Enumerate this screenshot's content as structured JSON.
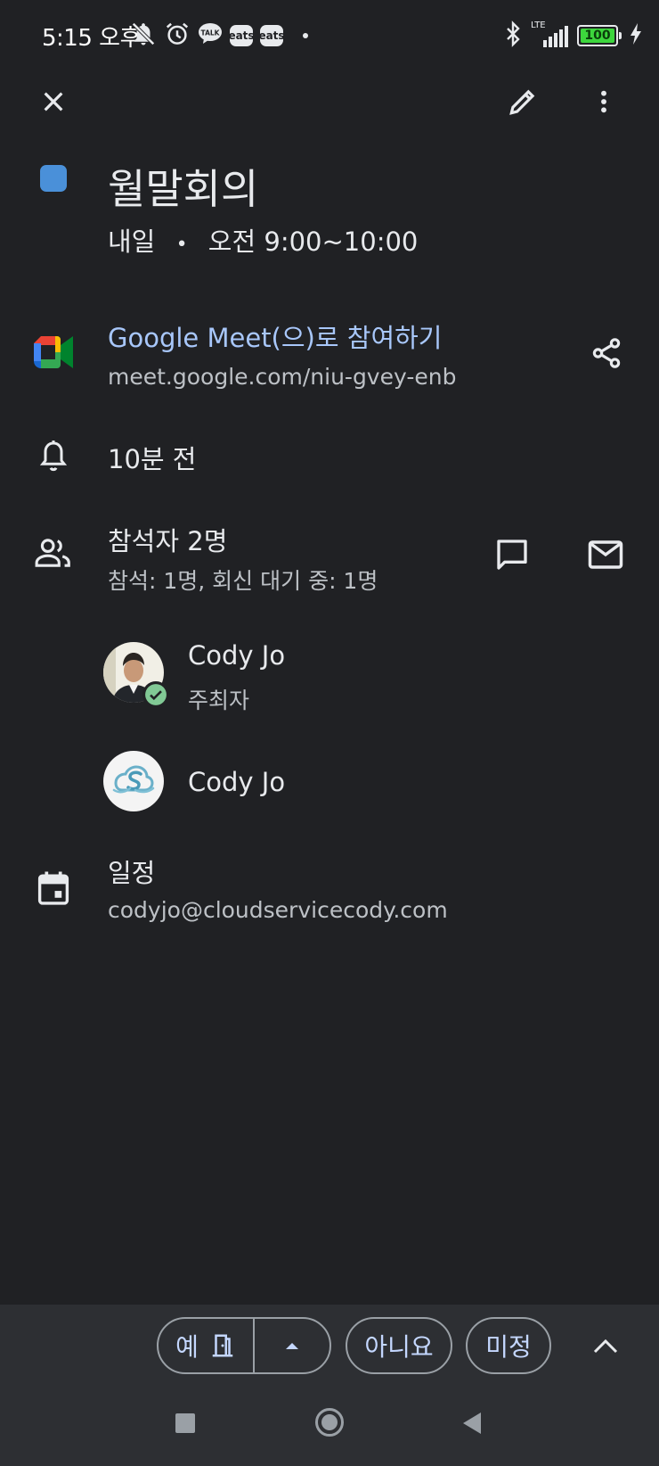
{
  "status_bar": {
    "time": "5:15 오후",
    "badge_talk": "TALK",
    "badge_eats_1": "eats",
    "badge_eats_2": "eats",
    "network": "LTE",
    "battery": "100"
  },
  "toolbar": {
    "close_icon": "close-icon",
    "edit_icon": "pencil-icon",
    "more_icon": "more-vert-icon"
  },
  "event": {
    "color": "#4a90d9",
    "title": "월말회의",
    "day": "내일",
    "separator": "•",
    "time_range": "오전 9:00~10:00"
  },
  "meet": {
    "join_label": "Google Meet(으)로 참여하기",
    "url": "meet.google.com/niu-gvey-enb"
  },
  "reminder": {
    "label": "10분 전"
  },
  "guests": {
    "count_label": "참석자 2명",
    "summary": "참석: 1명, 회신 대기 중: 1명",
    "list": [
      {
        "name": "Cody Jo",
        "role": "주최자",
        "accepted": true
      },
      {
        "name": "Cody Jo"
      }
    ]
  },
  "calendar": {
    "label": "일정",
    "account": "codyjo@cloudservicecody.com"
  },
  "rsvp": {
    "yes": "예",
    "no": "아니요",
    "maybe": "미정"
  },
  "colors": {
    "background": "#202124",
    "link": "#a8c7fa",
    "accept_green": "#81c995"
  }
}
